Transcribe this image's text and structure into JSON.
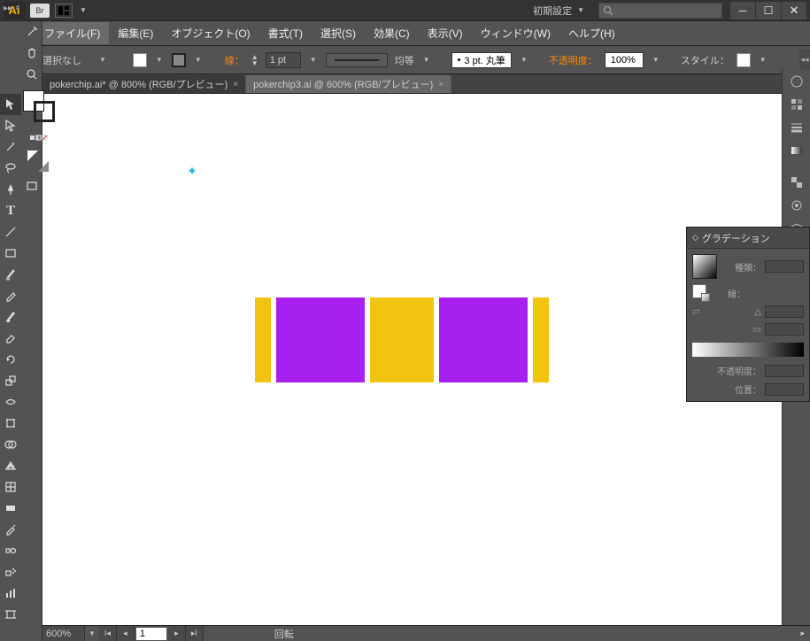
{
  "titlebar": {
    "logo": "Ai",
    "bridge_badge": "Br",
    "preset_label": "初期設定",
    "search_placeholder": ""
  },
  "menu": {
    "items": [
      "ファイル(F)",
      "編集(E)",
      "オブジェクト(O)",
      "書式(T)",
      "選択(S)",
      "効果(C)",
      "表示(V)",
      "ウィンドウ(W)",
      "ヘルプ(H)"
    ]
  },
  "controlbar": {
    "no_selection": "選択なし",
    "stroke_label": "線：",
    "stroke_weight": "1 pt",
    "stroke_uniform": "均等",
    "brush_value": "3 pt. 丸筆",
    "opacity_label": "不透明度：",
    "opacity_value": "100%",
    "style_label": "スタイル："
  },
  "tabs": [
    {
      "label": "pokerchip.ai* @ 800% (RGB/プレビュー)",
      "active": false
    },
    {
      "label": "pokerchip3.ai @ 600% (RGB/プレビュー)",
      "active": true
    }
  ],
  "artwork": {
    "colors": {
      "yellow": "#f1c40f",
      "purple": "#a820f0"
    }
  },
  "panel": {
    "title": "グラデーション",
    "type_label": "種類：",
    "stroke_label": "線：",
    "angle_label": "",
    "opacity_label": "不透明度：",
    "position_label": "位置："
  },
  "statusbar": {
    "zoom": "600%",
    "page": "1",
    "mode": "回転"
  },
  "tools": [
    "selection",
    "direct-selection",
    "magic-wand",
    "lasso",
    "pen",
    "type",
    "line",
    "rectangle",
    "paintbrush",
    "pencil",
    "blob-brush",
    "eraser",
    "rotate",
    "scale",
    "width",
    "free-transform",
    "shape-builder",
    "perspective",
    "mesh",
    "gradient",
    "eyedropper",
    "blend",
    "symbol-sprayer",
    "column-graph",
    "artboard",
    "slice",
    "hand",
    "zoom"
  ]
}
